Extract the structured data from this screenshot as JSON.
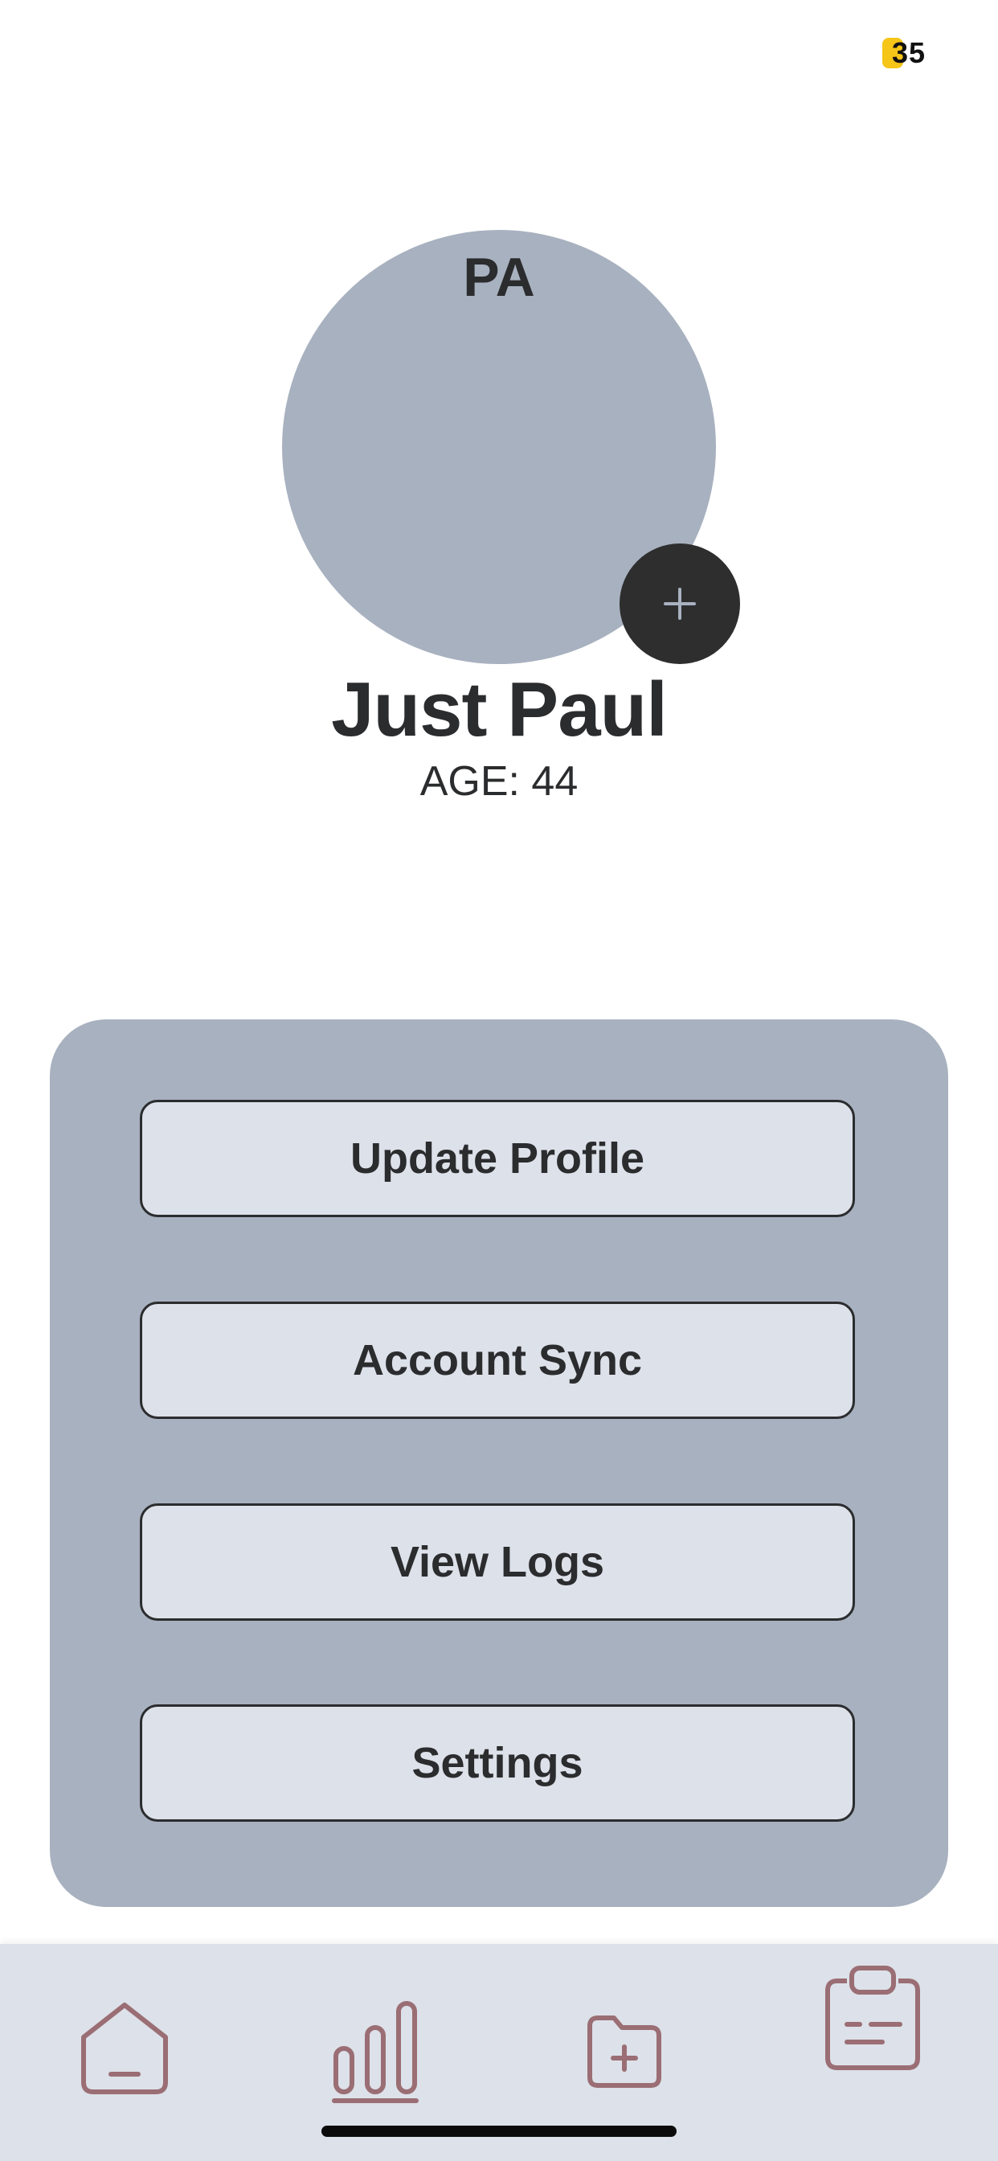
{
  "status": {
    "badge_number": "35",
    "badge_color": "#f5c518"
  },
  "profile": {
    "initials": "PA",
    "name": "Just Paul",
    "age_text": "AGE: 44",
    "avatar_color": "#a8b1bf",
    "add_photo_icon": "plus-icon"
  },
  "actions": {
    "update_profile": "Update Profile",
    "account_sync": "Account Sync",
    "view_logs": "View Logs",
    "settings": "Settings"
  },
  "tab_bar": {
    "icon_color": "#9a6e74",
    "background": "#dde1e9",
    "items": [
      {
        "icon": "home-icon"
      },
      {
        "icon": "bar-chart-icon"
      },
      {
        "icon": "folder-add-icon"
      },
      {
        "icon": "clipboard-icon"
      }
    ]
  }
}
